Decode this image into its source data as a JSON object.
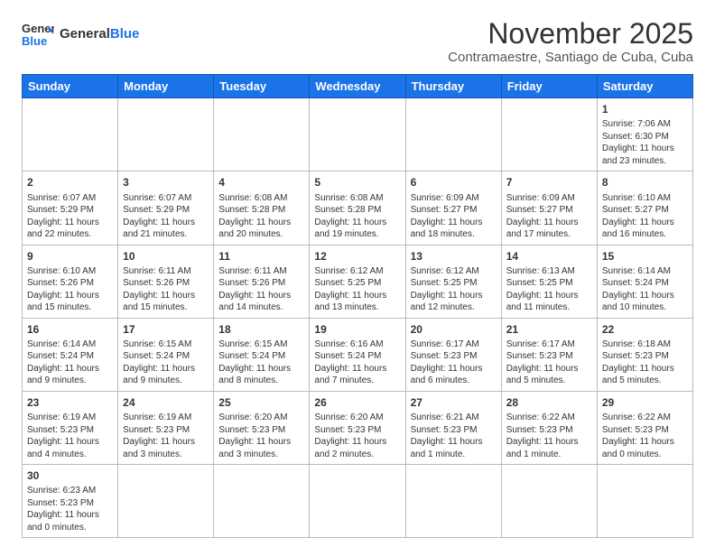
{
  "header": {
    "logo_line1": "General",
    "logo_line2": "Blue",
    "month_title": "November 2025",
    "subtitle": "Contramaestre, Santiago de Cuba, Cuba"
  },
  "weekdays": [
    "Sunday",
    "Monday",
    "Tuesday",
    "Wednesday",
    "Thursday",
    "Friday",
    "Saturday"
  ],
  "weeks": [
    [
      {
        "day": "",
        "info": ""
      },
      {
        "day": "",
        "info": ""
      },
      {
        "day": "",
        "info": ""
      },
      {
        "day": "",
        "info": ""
      },
      {
        "day": "",
        "info": ""
      },
      {
        "day": "",
        "info": ""
      },
      {
        "day": "1",
        "info": "Sunrise: 7:06 AM\nSunset: 6:30 PM\nDaylight: 11 hours\nand 23 minutes."
      }
    ],
    [
      {
        "day": "2",
        "info": "Sunrise: 6:07 AM\nSunset: 5:29 PM\nDaylight: 11 hours\nand 22 minutes."
      },
      {
        "day": "3",
        "info": "Sunrise: 6:07 AM\nSunset: 5:29 PM\nDaylight: 11 hours\nand 21 minutes."
      },
      {
        "day": "4",
        "info": "Sunrise: 6:08 AM\nSunset: 5:28 PM\nDaylight: 11 hours\nand 20 minutes."
      },
      {
        "day": "5",
        "info": "Sunrise: 6:08 AM\nSunset: 5:28 PM\nDaylight: 11 hours\nand 19 minutes."
      },
      {
        "day": "6",
        "info": "Sunrise: 6:09 AM\nSunset: 5:27 PM\nDaylight: 11 hours\nand 18 minutes."
      },
      {
        "day": "7",
        "info": "Sunrise: 6:09 AM\nSunset: 5:27 PM\nDaylight: 11 hours\nand 17 minutes."
      },
      {
        "day": "8",
        "info": "Sunrise: 6:10 AM\nSunset: 5:27 PM\nDaylight: 11 hours\nand 16 minutes."
      }
    ],
    [
      {
        "day": "9",
        "info": "Sunrise: 6:10 AM\nSunset: 5:26 PM\nDaylight: 11 hours\nand 15 minutes."
      },
      {
        "day": "10",
        "info": "Sunrise: 6:11 AM\nSunset: 5:26 PM\nDaylight: 11 hours\nand 15 minutes."
      },
      {
        "day": "11",
        "info": "Sunrise: 6:11 AM\nSunset: 5:26 PM\nDaylight: 11 hours\nand 14 minutes."
      },
      {
        "day": "12",
        "info": "Sunrise: 6:12 AM\nSunset: 5:25 PM\nDaylight: 11 hours\nand 13 minutes."
      },
      {
        "day": "13",
        "info": "Sunrise: 6:12 AM\nSunset: 5:25 PM\nDaylight: 11 hours\nand 12 minutes."
      },
      {
        "day": "14",
        "info": "Sunrise: 6:13 AM\nSunset: 5:25 PM\nDaylight: 11 hours\nand 11 minutes."
      },
      {
        "day": "15",
        "info": "Sunrise: 6:14 AM\nSunset: 5:24 PM\nDaylight: 11 hours\nand 10 minutes."
      }
    ],
    [
      {
        "day": "16",
        "info": "Sunrise: 6:14 AM\nSunset: 5:24 PM\nDaylight: 11 hours\nand 9 minutes."
      },
      {
        "day": "17",
        "info": "Sunrise: 6:15 AM\nSunset: 5:24 PM\nDaylight: 11 hours\nand 9 minutes."
      },
      {
        "day": "18",
        "info": "Sunrise: 6:15 AM\nSunset: 5:24 PM\nDaylight: 11 hours\nand 8 minutes."
      },
      {
        "day": "19",
        "info": "Sunrise: 6:16 AM\nSunset: 5:24 PM\nDaylight: 11 hours\nand 7 minutes."
      },
      {
        "day": "20",
        "info": "Sunrise: 6:17 AM\nSunset: 5:23 PM\nDaylight: 11 hours\nand 6 minutes."
      },
      {
        "day": "21",
        "info": "Sunrise: 6:17 AM\nSunset: 5:23 PM\nDaylight: 11 hours\nand 5 minutes."
      },
      {
        "day": "22",
        "info": "Sunrise: 6:18 AM\nSunset: 5:23 PM\nDaylight: 11 hours\nand 5 minutes."
      }
    ],
    [
      {
        "day": "23",
        "info": "Sunrise: 6:19 AM\nSunset: 5:23 PM\nDaylight: 11 hours\nand 4 minutes."
      },
      {
        "day": "24",
        "info": "Sunrise: 6:19 AM\nSunset: 5:23 PM\nDaylight: 11 hours\nand 3 minutes."
      },
      {
        "day": "25",
        "info": "Sunrise: 6:20 AM\nSunset: 5:23 PM\nDaylight: 11 hours\nand 3 minutes."
      },
      {
        "day": "26",
        "info": "Sunrise: 6:20 AM\nSunset: 5:23 PM\nDaylight: 11 hours\nand 2 minutes."
      },
      {
        "day": "27",
        "info": "Sunrise: 6:21 AM\nSunset: 5:23 PM\nDaylight: 11 hours\nand 1 minute."
      },
      {
        "day": "28",
        "info": "Sunrise: 6:22 AM\nSunset: 5:23 PM\nDaylight: 11 hours\nand 1 minute."
      },
      {
        "day": "29",
        "info": "Sunrise: 6:22 AM\nSunset: 5:23 PM\nDaylight: 11 hours\nand 0 minutes."
      }
    ],
    [
      {
        "day": "30",
        "info": "Sunrise: 6:23 AM\nSunset: 5:23 PM\nDaylight: 11 hours\nand 0 minutes."
      },
      {
        "day": "",
        "info": ""
      },
      {
        "day": "",
        "info": ""
      },
      {
        "day": "",
        "info": ""
      },
      {
        "day": "",
        "info": ""
      },
      {
        "day": "",
        "info": ""
      },
      {
        "day": "",
        "info": ""
      }
    ]
  ]
}
